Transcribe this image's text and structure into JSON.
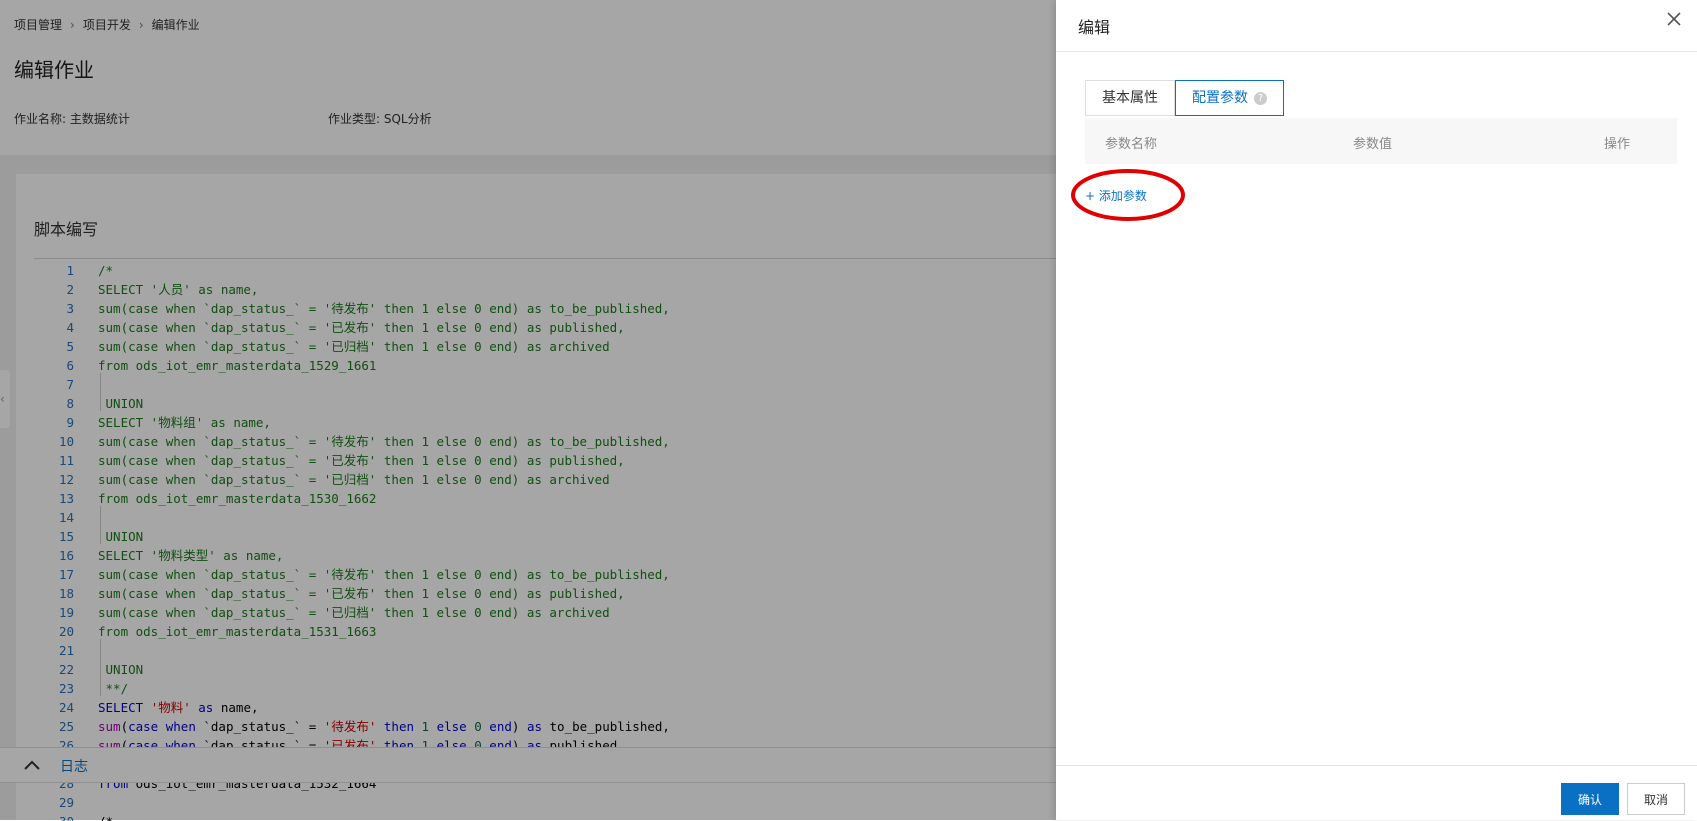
{
  "breadcrumb": {
    "items": [
      "项目管理",
      "项目开发",
      "编辑作业"
    ],
    "separator": "›"
  },
  "page_title": "编辑作业",
  "meta": {
    "job_name": "作业名称: 主数据统计",
    "job_type": "作业类型: SQL分析"
  },
  "script_section": {
    "title": "脚本编写"
  },
  "code_lines": [
    {
      "n": "1",
      "t": "/*"
    },
    {
      "n": "2",
      "t": "SELECT '人员' as name,"
    },
    {
      "n": "3",
      "t": "sum(case when `dap_status_` = '待发布' then 1 else 0 end) as to_be_published,"
    },
    {
      "n": "4",
      "t": "sum(case when `dap_status_` = '已发布' then 1 else 0 end) as published,"
    },
    {
      "n": "5",
      "t": "sum(case when `dap_status_` = '已归档' then 1 else 0 end) as archived"
    },
    {
      "n": "6",
      "t": "from ods_iot_emr_masterdata_1529_1661"
    },
    {
      "n": "7",
      "t": ""
    },
    {
      "n": "8",
      "t": " UNION"
    },
    {
      "n": "9",
      "t": "SELECT '物料组' as name,"
    },
    {
      "n": "10",
      "t": "sum(case when `dap_status_` = '待发布' then 1 else 0 end) as to_be_published,"
    },
    {
      "n": "11",
      "t": "sum(case when `dap_status_` = '已发布' then 1 else 0 end) as published,"
    },
    {
      "n": "12",
      "t": "sum(case when `dap_status_` = '已归档' then 1 else 0 end) as archived"
    },
    {
      "n": "13",
      "t": "from ods_iot_emr_masterdata_1530_1662"
    },
    {
      "n": "14",
      "t": ""
    },
    {
      "n": "15",
      "t": " UNION"
    },
    {
      "n": "16",
      "t": "SELECT '物料类型' as name,"
    },
    {
      "n": "17",
      "t": "sum(case when `dap_status_` = '待发布' then 1 else 0 end) as to_be_published,"
    },
    {
      "n": "18",
      "t": "sum(case when `dap_status_` = '已发布' then 1 else 0 end) as published,"
    },
    {
      "n": "19",
      "t": "sum(case when `dap_status_` = '已归档' then 1 else 0 end) as archived"
    },
    {
      "n": "20",
      "t": "from ods_iot_emr_masterdata_1531_1663"
    },
    {
      "n": "21",
      "t": ""
    },
    {
      "n": "22",
      "t": " UNION"
    },
    {
      "n": "23",
      "t": " **/"
    }
  ],
  "code_active": [
    {
      "n": "24",
      "t": "SELECT '物料' as name,"
    },
    {
      "n": "25",
      "t": "sum(case when `dap_status_` = '待发布' then 1 else 0 end) as to_be_published,"
    },
    {
      "n": "26",
      "t": "sum(case when `dap_status_` = '已发布' then 1 else 0 end) as published,"
    },
    {
      "n": "28",
      "t": "from ods_iot_emr_masterdata_1532_1664"
    },
    {
      "n": "29",
      "t": ""
    },
    {
      "n": "30",
      "t": "/*"
    }
  ],
  "log_bar": {
    "label": "日志"
  },
  "drawer": {
    "title": "编辑",
    "tabs": [
      "基本属性",
      "配置参数"
    ],
    "active_tab": 1,
    "help_glyph": "?",
    "table_headers": [
      "参数名称",
      "参数值",
      "操作"
    ],
    "add_param": "+ 添加参数",
    "confirm": "确认",
    "cancel": "取消"
  },
  "colors": {
    "accent": "#0a70c4",
    "highlight": "#e00000"
  }
}
